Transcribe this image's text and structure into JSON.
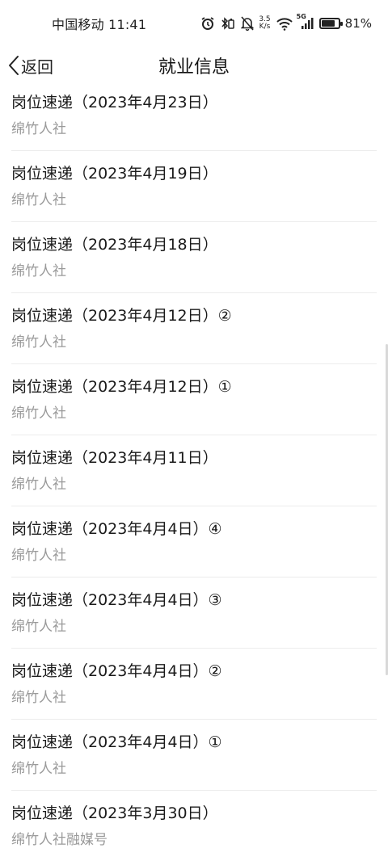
{
  "status_bar": {
    "carrier_time": "中国移动 11:41",
    "net_speed_value": "3.5",
    "net_speed_unit": "K/s",
    "signal_label": "5G",
    "battery_percent": "81%",
    "battery_level": 0.81
  },
  "nav": {
    "back_label": "返回",
    "title": "就业信息"
  },
  "list": {
    "items": [
      {
        "title": "岗位速递（2023年4月23日）",
        "source": "绵竹人社"
      },
      {
        "title": "岗位速递（2023年4月19日）",
        "source": "绵竹人社"
      },
      {
        "title": "岗位速递（2023年4月18日）",
        "source": "绵竹人社"
      },
      {
        "title": "岗位速递（2023年4月12日）②",
        "source": "绵竹人社"
      },
      {
        "title": "岗位速递（2023年4月12日）①",
        "source": "绵竹人社"
      },
      {
        "title": "岗位速递（2023年4月11日）",
        "source": "绵竹人社"
      },
      {
        "title": "岗位速递（2023年4月4日）④",
        "source": "绵竹人社"
      },
      {
        "title": "岗位速递（2023年4月4日）③",
        "source": "绵竹人社"
      },
      {
        "title": "岗位速递（2023年4月4日）②",
        "source": "绵竹人社"
      },
      {
        "title": "岗位速递（2023年4月4日）①",
        "source": "绵竹人社"
      },
      {
        "title": "岗位速递（2023年3月30日）",
        "source": "绵竹人社融媒号"
      }
    ]
  }
}
